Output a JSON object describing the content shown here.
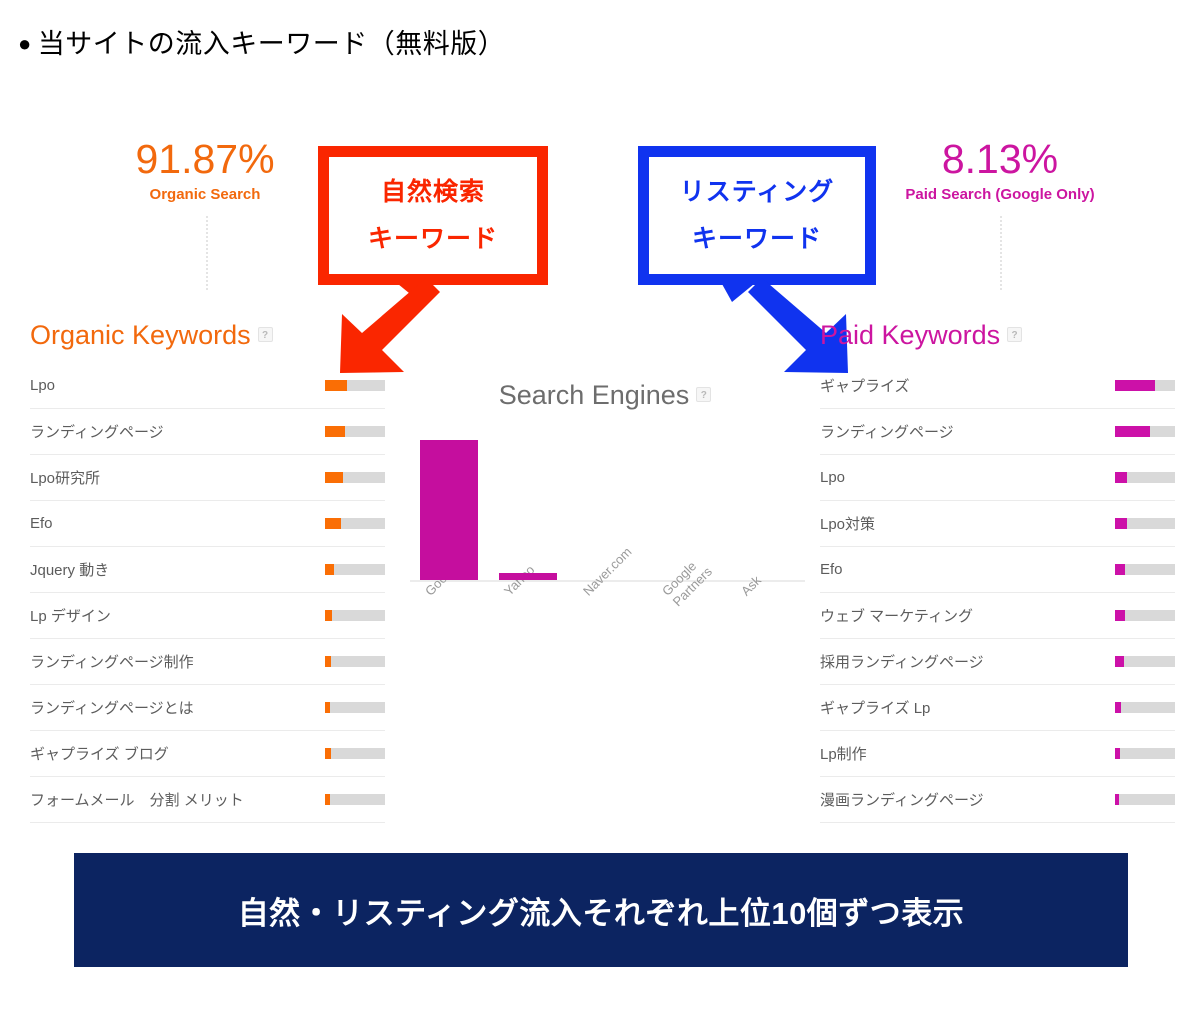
{
  "page": {
    "title": "当サイトの流入キーワード（無料版）",
    "bullet": "●"
  },
  "summary": {
    "organic": {
      "value": "91.87%",
      "label": "Organic Search",
      "color": "#f2690d"
    },
    "paid": {
      "value": "8.13%",
      "label": "Paid Search (Google Only)",
      "color": "#cc15a0"
    }
  },
  "callouts": {
    "organic": {
      "line1": "自然検索",
      "line2": "キーワード",
      "color": "#fa2600"
    },
    "paid": {
      "line1": "リスティング",
      "line2": "キーワード",
      "color": "#1033ef"
    }
  },
  "organic_panel": {
    "heading": "Organic Keywords",
    "help": "?",
    "rows": [
      {
        "name": "Lpo",
        "pct": 37
      },
      {
        "name": "ランディングページ",
        "pct": 33
      },
      {
        "name": "Lpo研究所",
        "pct": 30
      },
      {
        "name": "Efo",
        "pct": 26
      },
      {
        "name": "Jquery 動き",
        "pct": 15
      },
      {
        "name": "Lp デザイン",
        "pct": 11
      },
      {
        "name": "ランディングページ制作",
        "pct": 10
      },
      {
        "name": "ランディングページとは",
        "pct": 9
      },
      {
        "name": "ギャプライズ ブログ",
        "pct": 10
      },
      {
        "name": "フォームメール　分割 メリット",
        "pct": 9
      }
    ]
  },
  "paid_panel": {
    "heading": "Paid Keywords",
    "help": "?",
    "rows": [
      {
        "name": "ギャプライズ",
        "pct": 67
      },
      {
        "name": "ランディングページ",
        "pct": 58
      },
      {
        "name": "Lpo",
        "pct": 20
      },
      {
        "name": "Lpo対策",
        "pct": 20
      },
      {
        "name": "Efo",
        "pct": 17
      },
      {
        "name": "ウェブ マーケティング",
        "pct": 16
      },
      {
        "name": "採用ランディングページ",
        "pct": 15
      },
      {
        "name": "ギャプライズ Lp",
        "pct": 10
      },
      {
        "name": "Lp制作",
        "pct": 8
      },
      {
        "name": "漫画ランディングページ",
        "pct": 7
      }
    ]
  },
  "chart_data": {
    "type": "bar",
    "title": "Search Engines",
    "help": "?",
    "categories": [
      "Google",
      "Yahoo",
      "Naver.com",
      "Google\nPartners",
      "Ask"
    ],
    "values": [
      100,
      5,
      0,
      0,
      0
    ],
    "xlabel": "",
    "ylabel": "",
    "ylim": [
      0,
      100
    ],
    "grid": false,
    "legend": false,
    "bar_color": "#c50e9e"
  },
  "banner": {
    "text": "自然・リスティング流入それぞれ上位10個ずつ表示",
    "background": "#0c2461",
    "color": "#ffffff"
  }
}
